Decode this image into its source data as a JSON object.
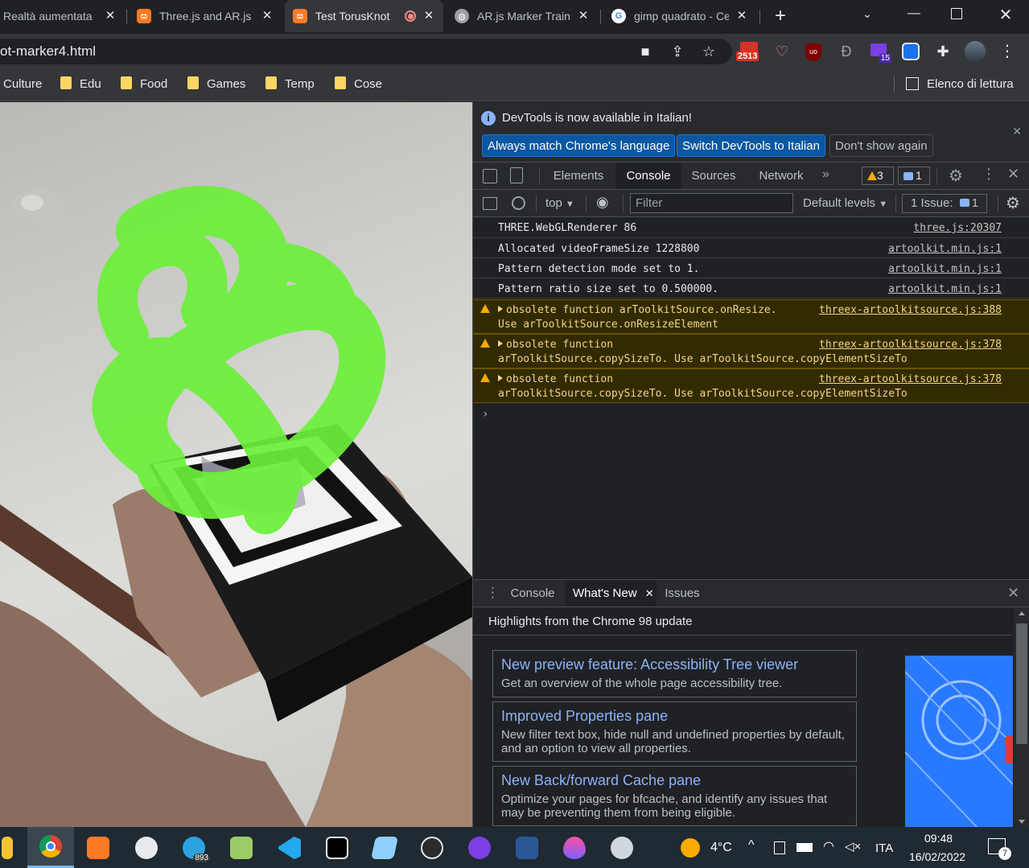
{
  "tabs": [
    {
      "title": "Realtà aumentata",
      "favicon": "partial-icon"
    },
    {
      "title": "Three.js and AR.js",
      "favicon": "xampp-icon"
    },
    {
      "title": "Test TorusKnot",
      "favicon": "xampp-icon",
      "recording": true
    },
    {
      "title": "AR.js Marker Training",
      "favicon": "globe-icon"
    },
    {
      "title": "gimp quadrato - Cerca con Google",
      "favicon": "google-icon"
    }
  ],
  "address": {
    "url": "ot-marker4.html"
  },
  "extensions": {
    "badge_count": "2513",
    "badge2_count": "15"
  },
  "bookmarks": [
    {
      "label": "Culture"
    },
    {
      "label": "Edu"
    },
    {
      "label": "Food"
    },
    {
      "label": "Games"
    },
    {
      "label": "Temp"
    },
    {
      "label": "Cose"
    }
  ],
  "reading_list": "Elenco di lettura",
  "devtools": {
    "infobar": {
      "message": "DevTools is now available in Italian!",
      "btn_match": "Always match Chrome's language",
      "btn_switch": "Switch DevTools to Italian",
      "btn_dismiss": "Don't show again"
    },
    "tabs": [
      "Elements",
      "Console",
      "Sources",
      "Network"
    ],
    "warning_count": "3",
    "message_count": "1",
    "context": "top",
    "filter_placeholder": "Filter",
    "levels": "Default levels",
    "issues_label": "1 Issue:",
    "issues_count": "1",
    "console": [
      {
        "text": "THREE.WebGLRenderer 86",
        "source": "three.js:20307"
      },
      {
        "text": "Allocated videoFrameSize 1228800",
        "source": "artoolkit.min.js:1"
      },
      {
        "text": "Pattern detection mode set to 1.",
        "source": "artoolkit.min.js:1"
      },
      {
        "text": "Pattern ratio size set to 0.500000.",
        "source": "artoolkit.min.js:1"
      }
    ],
    "warnings": [
      {
        "line1": "obsolete function arToolkitSource.onResize.",
        "line2": "Use arToolkitSource.onResizeElement",
        "source": "threex-artoolkitsource.js:388"
      },
      {
        "line1": "obsolete function",
        "line2": "arToolkitSource.copySizeTo. Use arToolkitSource.copyElementSizeTo",
        "source": "threex-artoolkitsource.js:378"
      },
      {
        "line1": "obsolete function",
        "line2": "arToolkitSource.copySizeTo. Use arToolkitSource.copyElementSizeTo",
        "source": "threex-artoolkitsource.js:378"
      }
    ],
    "drawer": {
      "tabs": [
        "Console",
        "What's New",
        "Issues"
      ],
      "heading": "Highlights from the Chrome 98 update",
      "cards": [
        {
          "title": "New preview feature: Accessibility Tree viewer",
          "desc": "Get an overview of the whole page accessibility tree."
        },
        {
          "title": "Improved Properties pane",
          "desc": "New filter text box, hide null and undefined properties by default, and an option to view all properties."
        },
        {
          "title": "New Back/forward Cache pane",
          "desc": "Optimize your pages for bfcache, and identify any issues that may be preventing them from being eligible."
        }
      ]
    }
  },
  "taskbar": {
    "weather": "4°C",
    "language": "ITA",
    "time": "09:48",
    "date": "16/02/2022",
    "telegram_badge": "893",
    "notif_count": "7"
  },
  "colors": {
    "torus": "#6cf03a",
    "accent": "#8ab4f8",
    "warning": "#f2d58a"
  }
}
